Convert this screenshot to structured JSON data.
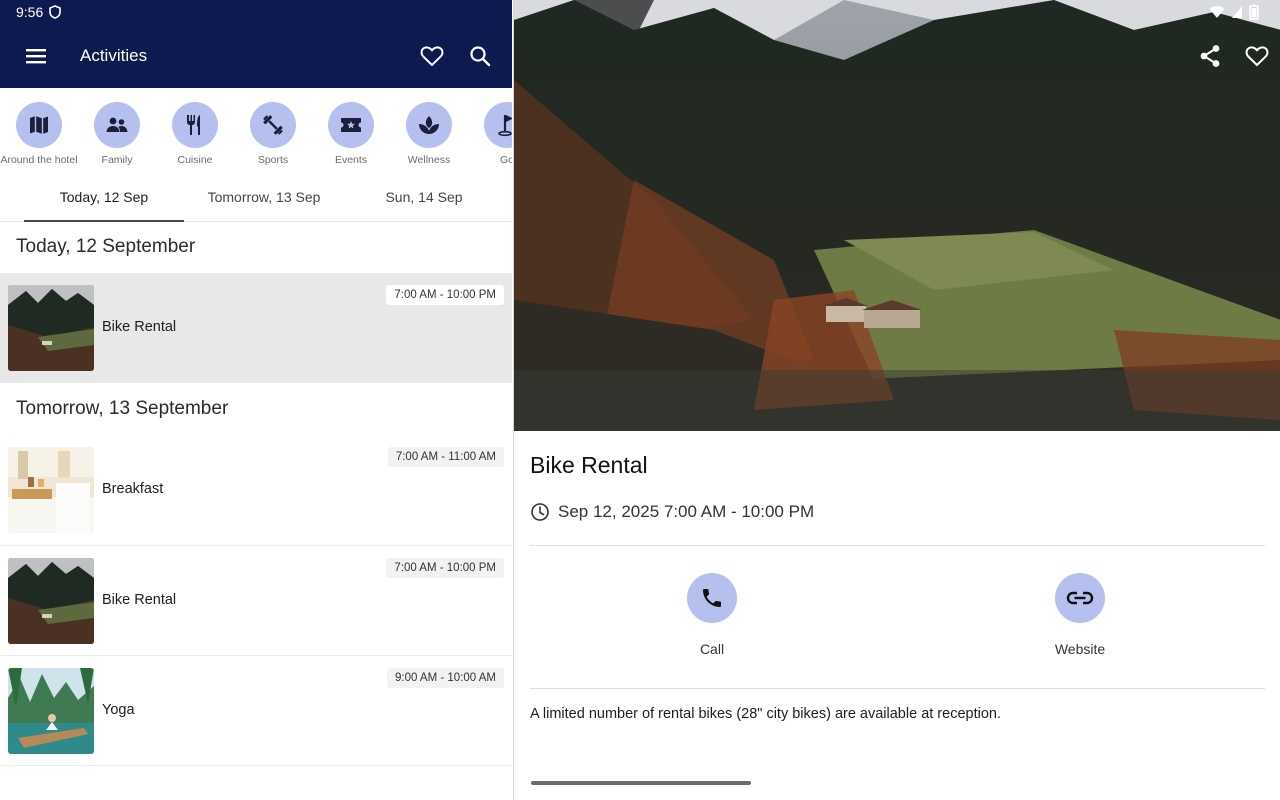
{
  "status_bar": {
    "time": "9:56"
  },
  "app_bar": {
    "title": "Activities"
  },
  "categories": [
    {
      "label": "Around the hotel",
      "icon": "map-icon"
    },
    {
      "label": "Family",
      "icon": "family-icon"
    },
    {
      "label": "Cuisine",
      "icon": "restaurant-icon"
    },
    {
      "label": "Sports",
      "icon": "fitness-icon"
    },
    {
      "label": "Events",
      "icon": "ticket-icon"
    },
    {
      "label": "Wellness",
      "icon": "spa-icon"
    },
    {
      "label": "Go",
      "icon": "golf-icon"
    }
  ],
  "day_tabs": [
    "Today, 12 Sep",
    "Tomorrow, 13 Sep",
    "Sun, 14 Sep"
  ],
  "sections": [
    {
      "heading": "Today, 12 September",
      "items": [
        {
          "title": "Bike Rental",
          "time": "7:00 AM - 10:00 PM",
          "selected": true,
          "thumb": "mountain"
        }
      ]
    },
    {
      "heading": "Tomorrow, 13 September",
      "items": [
        {
          "title": "Breakfast",
          "time": "7:00 AM - 11:00 AM",
          "selected": false,
          "thumb": "breakfast"
        },
        {
          "title": "Bike Rental",
          "time": "7:00 AM - 10:00 PM",
          "selected": false,
          "thumb": "mountain"
        },
        {
          "title": "Yoga",
          "time": "9:00 AM - 10:00 AM",
          "selected": false,
          "thumb": "yoga"
        }
      ]
    }
  ],
  "detail": {
    "title": "Bike Rental",
    "datetime": "Sep 12, 2025 7:00 AM - 10:00 PM",
    "actions": [
      {
        "label": "Call",
        "icon": "phone-icon"
      },
      {
        "label": "Website",
        "icon": "link-icon"
      }
    ],
    "description": "A limited number of rental bikes (28\" city bikes) are available at reception."
  },
  "colors": {
    "app_bar": "#0d1a4f",
    "accent_circle": "#b6c0ef",
    "selected_row": "#e8e8e8"
  }
}
